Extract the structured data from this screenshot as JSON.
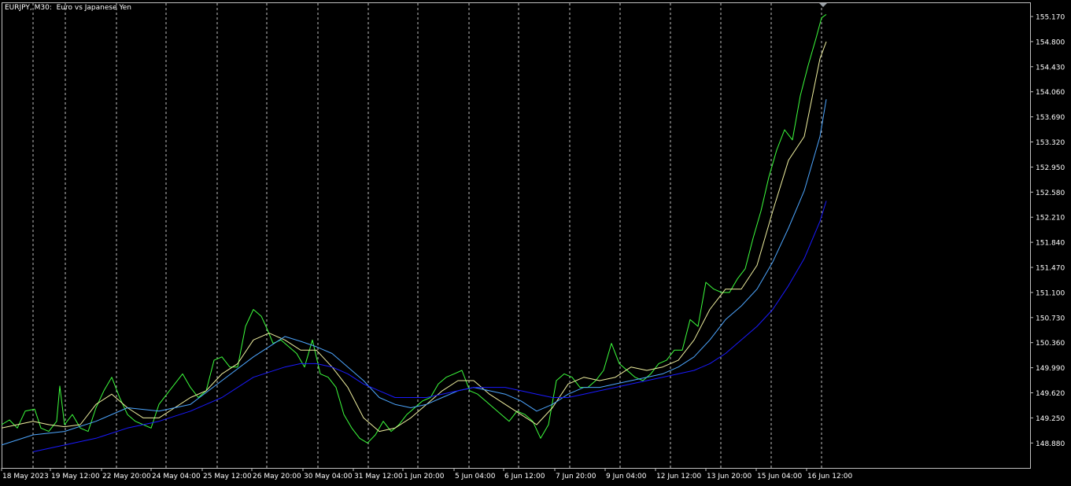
{
  "window": {
    "symbol_title": "EURJPY, M30:  Euro vs Japanese Yen"
  },
  "colors": {
    "background": "#000000",
    "frame": "#c0c0c0",
    "grid": "#c0c0c0",
    "price_line": "#3dff3d",
    "ma_fast": "#f0f0a0",
    "ma_mid": "#4da6ff",
    "ma_slow": "#1a1aff",
    "axis_text": "#ffffff"
  },
  "chart_data": {
    "type": "line",
    "symbol": "EURJPY",
    "timeframe": "M30",
    "grid": "vertical-dashed",
    "y_axis_ticks": [
      "155.170",
      "154.800",
      "154.430",
      "154.060",
      "153.690",
      "153.320",
      "152.950",
      "152.580",
      "152.210",
      "151.840",
      "151.470",
      "151.100",
      "150.730",
      "150.360",
      "149.990",
      "149.620",
      "149.250",
      "148.880"
    ],
    "x_axis_ticks": [
      "18 May 2023",
      "19 May 12:00",
      "22 May 20:00",
      "24 May 04:00",
      "25 May 12:00",
      "26 May 20:00",
      "30 May 04:00",
      "31 May 12:00",
      "1 Jun 20:00",
      "5 Jun 04:00",
      "6 Jun 12:00",
      "7 Jun 20:00",
      "9 Jun 04:00",
      "12 Jun 12:00",
      "13 Jun 20:00",
      "15 Jun 04:00",
      "16 Jun 12:00"
    ],
    "ylim": [
      148.75,
      155.3
    ],
    "x_range": [
      0,
      1048
    ],
    "series": [
      {
        "role": "price",
        "x": [
          0,
          10,
          20,
          30,
          42,
          50,
          60,
          70,
          74,
          80,
          90,
          100,
          110,
          120,
          130,
          140,
          150,
          160,
          170,
          180,
          190,
          200,
          210,
          220,
          230,
          240,
          250,
          260,
          270,
          280,
          290,
          300,
          310,
          320,
          330,
          336,
          345,
          355,
          365,
          375,
          385,
          395,
          405,
          415,
          425,
          435,
          445,
          455,
          465,
          475,
          485,
          495,
          505,
          515,
          525,
          535,
          545,
          555,
          565,
          575,
          585,
          595,
          605,
          615,
          625,
          635,
          645,
          655,
          665,
          675,
          685,
          695,
          705,
          715,
          725,
          735,
          745,
          755,
          765,
          775,
          785,
          795,
          805,
          815,
          825,
          835,
          845,
          855,
          865,
          875,
          885,
          895,
          905,
          915,
          925,
          935,
          945,
          955,
          965,
          975,
          985,
          995,
          1005,
          1015,
          1025,
          1035,
          1042,
          1048
        ],
        "values": [
          149.15,
          149.22,
          149.1,
          149.35,
          149.38,
          149.1,
          149.05,
          149.2,
          149.72,
          149.15,
          149.3,
          149.1,
          149.05,
          149.4,
          149.65,
          149.85,
          149.55,
          149.3,
          149.2,
          149.15,
          149.1,
          149.45,
          149.6,
          149.75,
          149.9,
          149.7,
          149.55,
          149.65,
          150.1,
          150.15,
          150.0,
          150.0,
          150.6,
          150.85,
          150.75,
          150.6,
          150.35,
          150.4,
          150.3,
          150.2,
          150.0,
          150.4,
          149.9,
          149.85,
          149.7,
          149.3,
          149.1,
          148.95,
          148.88,
          149.0,
          149.2,
          149.05,
          149.15,
          149.3,
          149.4,
          149.5,
          149.55,
          149.75,
          149.85,
          149.9,
          149.95,
          149.65,
          149.6,
          149.5,
          149.4,
          149.3,
          149.2,
          149.35,
          149.3,
          149.2,
          148.95,
          149.15,
          149.8,
          149.9,
          149.85,
          149.7,
          149.7,
          149.8,
          149.95,
          150.35,
          150.05,
          149.95,
          149.85,
          149.8,
          149.9,
          150.05,
          150.1,
          150.25,
          150.25,
          150.7,
          150.6,
          151.25,
          151.15,
          151.1,
          151.1,
          151.3,
          151.45,
          151.9,
          152.3,
          152.8,
          153.2,
          153.5,
          153.35,
          154.0,
          154.45,
          154.85,
          155.15,
          155.2
        ]
      },
      {
        "role": "ma-fast",
        "x": [
          0,
          20,
          40,
          60,
          80,
          100,
          120,
          140,
          160,
          180,
          200,
          220,
          240,
          260,
          280,
          300,
          320,
          340,
          360,
          380,
          400,
          420,
          440,
          460,
          480,
          500,
          520,
          540,
          560,
          580,
          600,
          620,
          640,
          660,
          680,
          700,
          720,
          740,
          760,
          780,
          800,
          820,
          840,
          860,
          880,
          900,
          920,
          940,
          960,
          980,
          1000,
          1020,
          1040,
          1048
        ],
        "values": [
          149.1,
          149.15,
          149.2,
          149.15,
          149.12,
          149.15,
          149.45,
          149.6,
          149.4,
          149.25,
          149.25,
          149.4,
          149.55,
          149.65,
          149.9,
          150.05,
          150.4,
          150.5,
          150.4,
          150.25,
          150.25,
          150.0,
          149.7,
          149.25,
          149.05,
          149.1,
          149.25,
          149.45,
          149.65,
          149.8,
          149.8,
          149.6,
          149.45,
          149.3,
          149.15,
          149.4,
          149.75,
          149.85,
          149.8,
          149.85,
          150.0,
          149.95,
          150.0,
          150.1,
          150.4,
          150.85,
          151.15,
          151.15,
          151.5,
          152.3,
          153.05,
          153.4,
          154.55,
          154.8
        ]
      },
      {
        "role": "ma-mid",
        "x": [
          0,
          40,
          80,
          120,
          160,
          200,
          240,
          280,
          320,
          360,
          380,
          400,
          420,
          440,
          460,
          480,
          500,
          520,
          540,
          560,
          580,
          600,
          620,
          640,
          660,
          680,
          700,
          720,
          740,
          760,
          780,
          800,
          820,
          840,
          860,
          880,
          900,
          920,
          940,
          960,
          980,
          1000,
          1020,
          1040,
          1048
        ],
        "values": [
          148.85,
          149.0,
          149.05,
          149.2,
          149.4,
          149.35,
          149.45,
          149.8,
          150.15,
          150.45,
          150.38,
          150.3,
          150.2,
          150.0,
          149.8,
          149.55,
          149.45,
          149.4,
          149.45,
          149.55,
          149.65,
          149.7,
          149.65,
          149.6,
          149.5,
          149.35,
          149.45,
          149.6,
          149.7,
          149.7,
          149.75,
          149.8,
          149.85,
          149.9,
          150.0,
          150.15,
          150.4,
          150.7,
          150.9,
          151.15,
          151.55,
          152.05,
          152.6,
          153.4,
          153.95
        ]
      },
      {
        "role": "ma-slow",
        "x": [
          40,
          80,
          120,
          160,
          200,
          240,
          280,
          320,
          360,
          380,
          400,
          420,
          440,
          460,
          480,
          500,
          520,
          540,
          560,
          580,
          600,
          620,
          640,
          660,
          680,
          700,
          720,
          740,
          760,
          780,
          800,
          820,
          840,
          860,
          880,
          900,
          920,
          940,
          960,
          980,
          1000,
          1020,
          1040,
          1048
        ],
        "values": [
          148.75,
          148.85,
          148.95,
          149.1,
          149.2,
          149.35,
          149.55,
          149.85,
          150.0,
          150.05,
          150.05,
          150.0,
          149.9,
          149.75,
          149.65,
          149.55,
          149.55,
          149.55,
          149.6,
          149.65,
          149.7,
          149.7,
          149.7,
          149.65,
          149.6,
          149.55,
          149.55,
          149.6,
          149.65,
          149.7,
          149.75,
          149.8,
          149.85,
          149.9,
          149.95,
          150.05,
          150.2,
          150.4,
          150.6,
          150.85,
          151.2,
          151.6,
          152.15,
          152.45
        ]
      }
    ]
  }
}
